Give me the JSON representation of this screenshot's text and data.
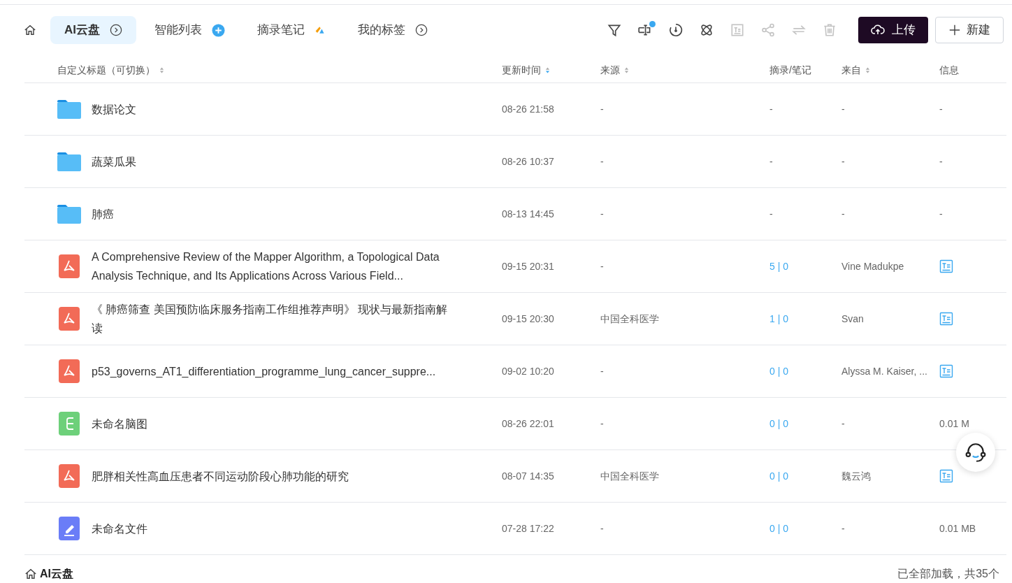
{
  "tabs": [
    {
      "label": "AI云盘",
      "selected": true,
      "kind": "chevron"
    },
    {
      "label": "智能列表",
      "selected": false,
      "kind": "plus"
    },
    {
      "label": "摘录笔记",
      "selected": false,
      "kind": "logo"
    },
    {
      "label": "我的标签",
      "selected": false,
      "kind": "chevron"
    }
  ],
  "toolbar": [
    {
      "kind": "filter",
      "disabled": false,
      "badge": false
    },
    {
      "kind": "fit",
      "disabled": false,
      "badge": true
    },
    {
      "kind": "clock",
      "disabled": false,
      "badge": false
    },
    {
      "kind": "atom",
      "disabled": false,
      "badge": false
    },
    {
      "kind": "doc",
      "disabled": true,
      "badge": false
    },
    {
      "kind": "share",
      "disabled": true,
      "badge": false
    },
    {
      "kind": "swap",
      "disabled": true,
      "badge": false
    },
    {
      "kind": "trash",
      "disabled": true,
      "badge": false
    }
  ],
  "upload_button": "上传",
  "new_button": "新建",
  "table": {
    "columns": [
      {
        "label": "自定义标题（可切换）",
        "sortable": true,
        "sorted": false
      },
      {
        "label": "更新时间",
        "sortable": true,
        "sorted": true
      },
      {
        "label": "来源",
        "sortable": true,
        "sorted": false
      },
      {
        "label": "摘录/笔记",
        "sortable": false
      },
      {
        "label": "来自",
        "sortable": true,
        "sorted": false
      },
      {
        "label": "信息",
        "sortable": false
      }
    ],
    "rows": [
      {
        "kind": "folder",
        "title": "数据论文",
        "time": "08-26 21:58",
        "source": "-",
        "notes": "-",
        "from": "-",
        "info_icon": false,
        "info": "-"
      },
      {
        "kind": "folder",
        "title": "蔬菜瓜果",
        "time": "08-26 10:37",
        "source": "-",
        "notes": "-",
        "from": "-",
        "info_icon": false,
        "info": "-"
      },
      {
        "kind": "folder",
        "title": "肺癌",
        "time": "08-13 14:45",
        "source": "-",
        "notes": "-",
        "from": "-",
        "info_icon": false,
        "info": "-"
      },
      {
        "kind": "pdf",
        "title": "A Comprehensive Review of the Mapper Algorithm, a Topological Data Analysis Technique, and Its Applications Across Various Field...",
        "time": "09-15 20:31",
        "source": "-",
        "notes": "5 | 0",
        "from": "Vine Madukpe",
        "info_icon": true
      },
      {
        "kind": "pdf",
        "title": "《 肺癌筛查 美国预防临床服务指南工作组推荐声明》 现状与最新指南解读",
        "time": "09-15 20:30",
        "source": "中国全科医学",
        "notes": "1 | 0",
        "from": "Svan",
        "info_icon": true
      },
      {
        "kind": "pdf",
        "title": "p53_governs_AT1_differentiation_programme_lung_cancer_suppre...",
        "time": "09-02 10:20",
        "source": "-",
        "notes": "0 | 0",
        "from": "Alyssa M. Kaiser, ...",
        "info_icon": true
      },
      {
        "kind": "mindmap",
        "title": "未命名脑图",
        "time": "08-26 22:01",
        "source": "-",
        "notes": "0 | 0",
        "from": "-",
        "info_icon": false,
        "info": "0.01 M"
      },
      {
        "kind": "pdf",
        "title": "肥胖相关性高血压患者不同运动阶段心肺功能的研究",
        "time": "08-07 14:35",
        "source": "中国全科医学",
        "notes": "0 | 0",
        "from": "魏云鸿",
        "info_icon": true
      },
      {
        "kind": "note",
        "title": "未命名文件",
        "time": "07-28 17:22",
        "source": "-",
        "notes": "0 | 0",
        "from": "-",
        "info_icon": false,
        "info": "0.01 MB"
      }
    ]
  },
  "footer": {
    "breadcrumb": "AI云盘",
    "status": "已全部加载，共35个"
  }
}
